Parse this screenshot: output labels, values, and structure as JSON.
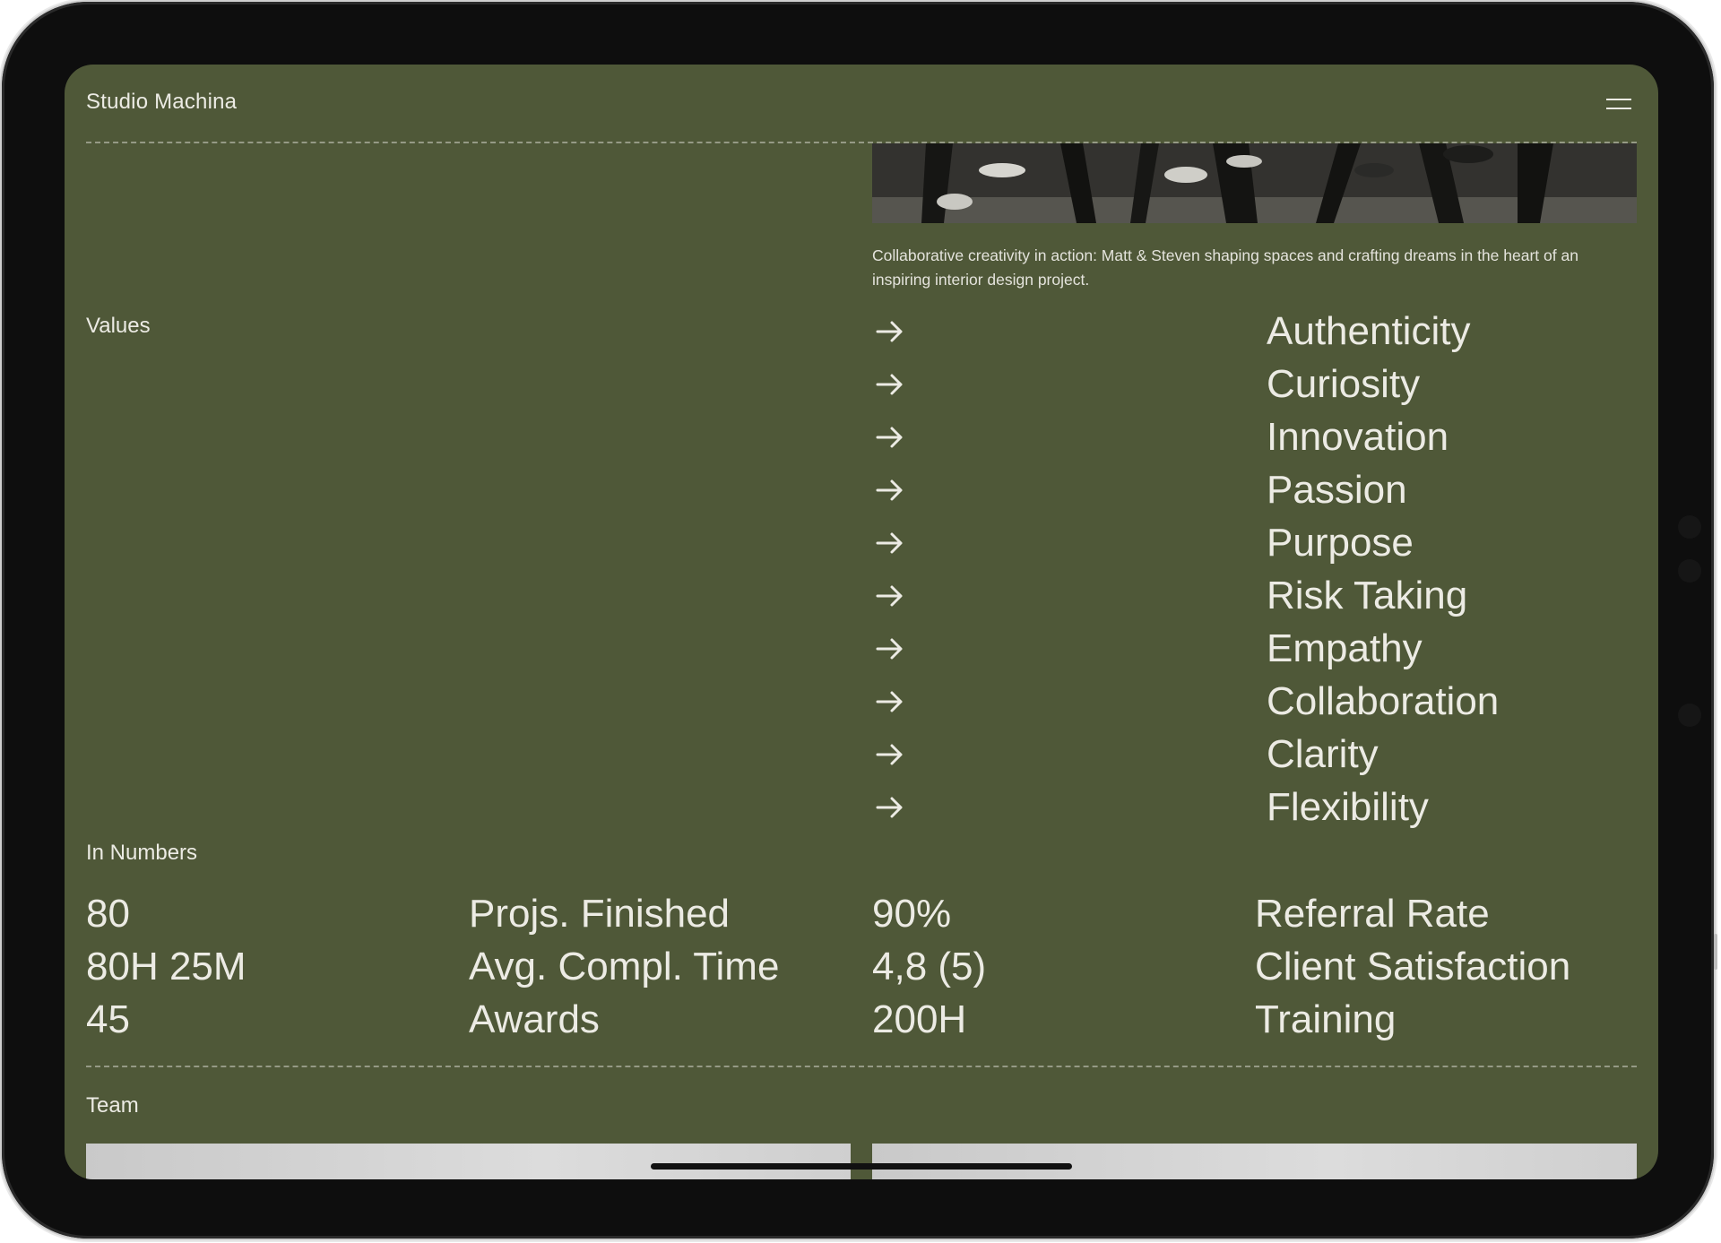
{
  "header": {
    "brand": "Studio Machina",
    "menu_icon": "hamburger-menu-icon"
  },
  "hero": {
    "caption": "Collaborative creativity in action: Matt & Steven shaping spaces and crafting dreams in the heart of an inspiring interior design project."
  },
  "values": {
    "label": "Values",
    "arrow_icon": "arrow-right-icon",
    "items": [
      {
        "label": "Authenticity"
      },
      {
        "label": "Curiosity"
      },
      {
        "label": "Innovation"
      },
      {
        "label": "Passion"
      },
      {
        "label": "Purpose"
      },
      {
        "label": "Risk Taking"
      },
      {
        "label": "Empathy"
      },
      {
        "label": "Collaboration"
      },
      {
        "label": "Clarity"
      },
      {
        "label": "Flexibility"
      }
    ]
  },
  "numbers": {
    "label": "In Numbers",
    "left": [
      {
        "value": "80",
        "label": "Projs. Finished"
      },
      {
        "value": "80H 25M",
        "label": "Avg. Compl. Time"
      },
      {
        "value": "45",
        "label": "Awards"
      }
    ],
    "right": [
      {
        "value": "90%",
        "label": "Referral Rate"
      },
      {
        "value": "4,8 (5)",
        "label": "Client Satisfaction"
      },
      {
        "value": "200H",
        "label": "Training"
      }
    ]
  },
  "team": {
    "label": "Team"
  },
  "colors": {
    "background": "#4f5838",
    "text": "#ecebe4"
  }
}
